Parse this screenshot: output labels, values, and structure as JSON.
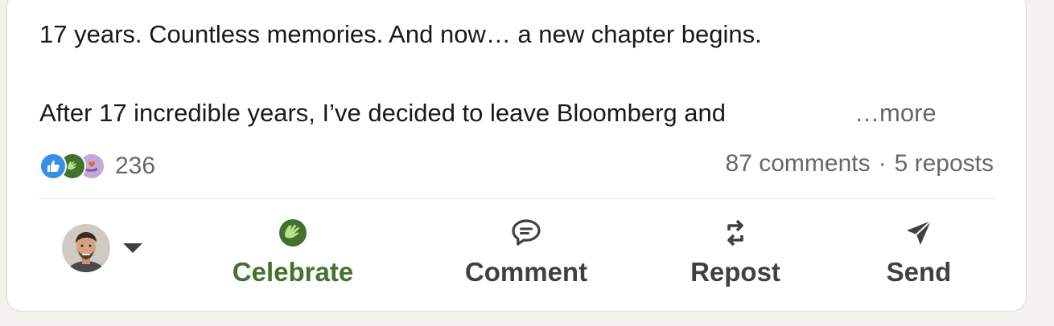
{
  "post": {
    "line1": "17 years. Countless memories. And now… a new chapter begins.",
    "line2": "After 17 incredible years, I’ve decided to leave Bloomberg and",
    "more_label": "…more"
  },
  "social": {
    "reaction_icons": [
      "like-icon",
      "celebrate-icon",
      "support-icon"
    ],
    "reaction_count": "236",
    "comments": "87 comments",
    "separator": "·",
    "reposts": "5 reposts"
  },
  "actions": {
    "celebrate": "Celebrate",
    "comment": "Comment",
    "repost": "Repost",
    "send": "Send"
  },
  "colors": {
    "celebrate_green": "#44712e",
    "like_blue": "#378fe9",
    "support_purple": "#c3a9d6"
  }
}
